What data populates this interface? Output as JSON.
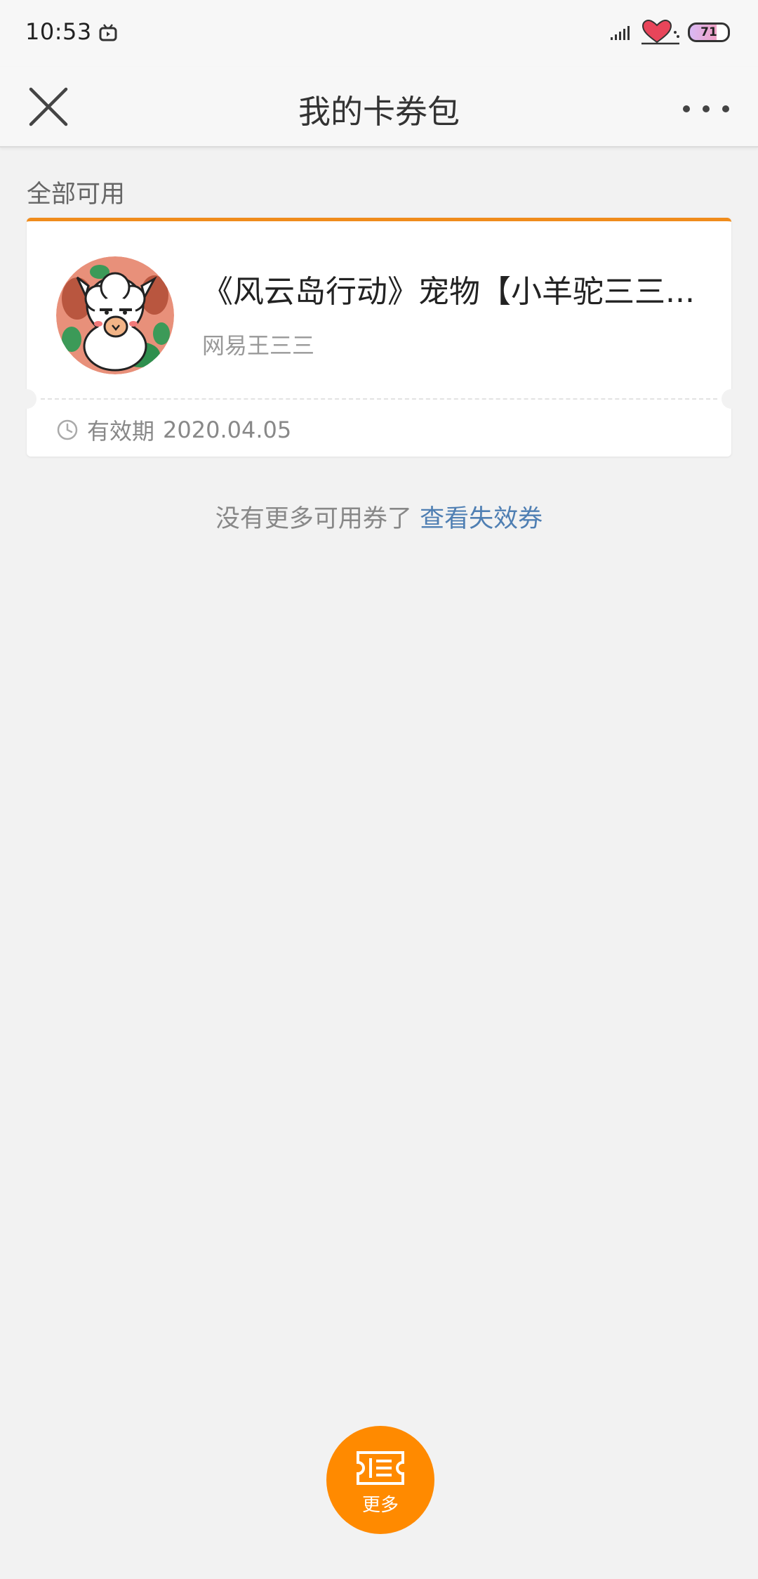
{
  "status_bar": {
    "time": "10:53",
    "battery_level": "71",
    "icons": [
      "tv-icon",
      "signal-icon",
      "heart-icon",
      "battery-icon"
    ]
  },
  "header": {
    "title": "我的卡券包",
    "close_icon": "close-icon",
    "more_icon": "more-dots-icon"
  },
  "section": {
    "label": "全部可用"
  },
  "coupons": [
    {
      "title": "《风云岛行动》宠物【小羊驼三三...",
      "issuer": "网易王三三",
      "validity_label": "有效期",
      "validity_date": "2020.04.05",
      "avatar_icon": "alpaca-avatar"
    }
  ],
  "footer": {
    "note": "没有更多可用券了",
    "link": "查看失效券"
  },
  "fab": {
    "label": "更多",
    "icon": "ticket-icon"
  },
  "colors": {
    "accent": "#f08c1c",
    "fab": "#ff8a00",
    "link": "#4f7fb3",
    "background": "#f2f2f2"
  }
}
